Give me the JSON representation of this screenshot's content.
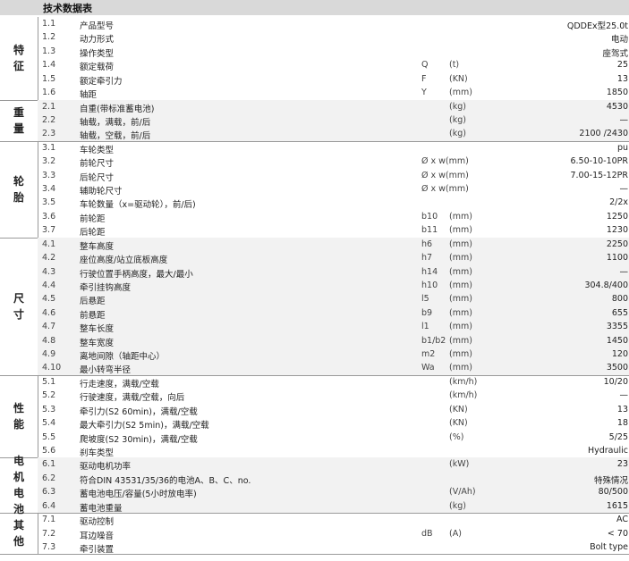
{
  "title": "技术数据表",
  "groups": [
    {
      "label": "特征",
      "rows": [
        {
          "num": "1.1",
          "name": "产品型号",
          "sym": "",
          "unit": "",
          "val": "QDDEx型25.0t"
        },
        {
          "num": "1.2",
          "name": "动力形式",
          "sym": "",
          "unit": "",
          "val": "电动"
        },
        {
          "num": "1.3",
          "name": "操作类型",
          "sym": "",
          "unit": "",
          "val": "座驾式"
        },
        {
          "num": "1.4",
          "name": "额定载荷",
          "sym": "Q",
          "unit": "(t)",
          "val": "25"
        },
        {
          "num": "1.5",
          "name": "额定牵引力",
          "sym": "F",
          "unit": "(KN)",
          "val": "13"
        },
        {
          "num": "1.6",
          "name": "轴距",
          "sym": "Y",
          "unit": "(mm)",
          "val": "1850"
        }
      ]
    },
    {
      "label": "重量",
      "rows": [
        {
          "num": "2.1",
          "name": "自重(带标准蓄电池)",
          "sym": "",
          "unit": "(kg)",
          "val": "4530"
        },
        {
          "num": "2.2",
          "name": "轴载，满载，前/后",
          "sym": "",
          "unit": "(kg)",
          "val": "—"
        },
        {
          "num": "2.3",
          "name": "轴载，空载，前/后",
          "sym": "",
          "unit": "(kg)",
          "val": "2100 /2430"
        }
      ]
    },
    {
      "label": "轮胎",
      "rows": [
        {
          "num": "3.1",
          "name": "车轮类型",
          "sym": "",
          "unit": "",
          "val": "pu"
        },
        {
          "num": "3.2",
          "name": "前轮尺寸",
          "sym": "Ø x w(mm)",
          "unit": "",
          "val": "6.50-10-10PR"
        },
        {
          "num": "3.3",
          "name": "后轮尺寸",
          "sym": "Ø x w(mm)",
          "unit": "",
          "val": "7.00-15-12PR"
        },
        {
          "num": "3.4",
          "name": "辅助轮尺寸",
          "sym": "Ø x w(mm)",
          "unit": "",
          "val": "—"
        },
        {
          "num": "3.5",
          "name": "车轮数量（x=驱动轮），前/后)",
          "sym": "",
          "unit": "",
          "val": "2/2x"
        },
        {
          "num": "3.6",
          "name": "前轮距",
          "sym": "b10",
          "unit": "(mm)",
          "val": "1250"
        },
        {
          "num": "3.7",
          "name": "后轮距",
          "sym": "b11",
          "unit": "(mm)",
          "val": "1230"
        }
      ]
    },
    {
      "label": "尺寸",
      "rows": [
        {
          "num": "4.1",
          "name": "整车高度",
          "sym": "h6",
          "unit": "(mm)",
          "val": "2250"
        },
        {
          "num": "4.2",
          "name": "座位高度/站立底板高度",
          "sym": "h7",
          "unit": "(mm)",
          "val": "1100"
        },
        {
          "num": "4.3",
          "name": "行驶位置手柄高度，最大/最小",
          "sym": "h14",
          "unit": "(mm)",
          "val": "—"
        },
        {
          "num": "4.4",
          "name": "牵引挂钩高度",
          "sym": "h10",
          "unit": "(mm)",
          "val": "304.8/400"
        },
        {
          "num": "4.5",
          "name": "后悬距",
          "sym": "l5",
          "unit": "(mm)",
          "val": "800"
        },
        {
          "num": "4.6",
          "name": "前悬距",
          "sym": "b9",
          "unit": "(mm)",
          "val": "655"
        },
        {
          "num": "4.7",
          "name": "整车长度",
          "sym": "l1",
          "unit": "(mm)",
          "val": "3355"
        },
        {
          "num": "4.8",
          "name": "整车宽度",
          "sym": "b1/b2",
          "unit": "(mm)",
          "val": "1450"
        },
        {
          "num": "4.9",
          "name": "离地间隙（轴距中心）",
          "sym": "m2",
          "unit": "(mm)",
          "val": "120"
        },
        {
          "num": "4.10",
          "name": "最小转弯半径",
          "sym": "Wa",
          "unit": "(mm)",
          "val": "3500"
        }
      ]
    },
    {
      "label": "性能",
      "rows": [
        {
          "num": "5.1",
          "name": "行走速度，满载/空载",
          "sym": "",
          "unit": "(km/h)",
          "val": "10/20"
        },
        {
          "num": "5.2",
          "name": "行驶速度，满载/空载，向后",
          "sym": "",
          "unit": "(km/h)",
          "val": "—"
        },
        {
          "num": "5.3",
          "name": "牵引力(S2 60min)，满载/空载",
          "sym": "",
          "unit": "(KN)",
          "val": "13"
        },
        {
          "num": "5.4",
          "name": "最大牵引力(S2 5min)，满载/空载",
          "sym": "",
          "unit": "(KN)",
          "val": "18"
        },
        {
          "num": "5.5",
          "name": "爬坡度(S2 30min)，满载/空载",
          "sym": "",
          "unit": "(%)",
          "val": "5/25"
        },
        {
          "num": "5.6",
          "name": "刹车类型",
          "sym": "",
          "unit": "",
          "val": "Hydraulic"
        }
      ]
    },
    {
      "label": "电机电池",
      "rows": [
        {
          "num": "6.1",
          "name": "驱动电机功率",
          "sym": "",
          "unit": "(kW)",
          "val": "23"
        },
        {
          "num": "6.2",
          "name": "符合DIN 43531/35/36的电池A、B、C、no.",
          "sym": "",
          "unit": "",
          "val": "特殊情况"
        },
        {
          "num": "6.3",
          "name": "蓄电池电压/容量(5小时放电率)",
          "sym": "",
          "unit": "(V/Ah)",
          "val": "80/500"
        },
        {
          "num": "6.4",
          "name": "蓄电池重量",
          "sym": "",
          "unit": "(kg)",
          "val": "1615"
        }
      ]
    },
    {
      "label": "其他",
      "rows": [
        {
          "num": "7.1",
          "name": "驱动控制",
          "sym": "",
          "unit": "",
          "val": "AC"
        },
        {
          "num": "7.2",
          "name": "耳边噪音",
          "sym": "dB",
          "unit": "(A)",
          "val": "< 70"
        },
        {
          "num": "7.3",
          "name": "牵引装置",
          "sym": "",
          "unit": "",
          "val": "Bolt type"
        }
      ]
    }
  ]
}
